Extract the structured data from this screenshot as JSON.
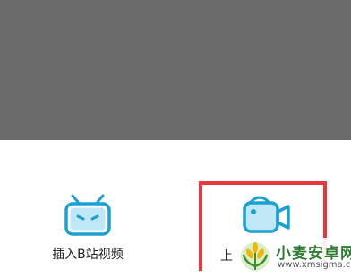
{
  "colors": {
    "overlay": "#6b6b6b",
    "icon_accent": "#1ba0d1",
    "highlight_border": "#e8383d",
    "watermark_green": "#2e7d32"
  },
  "options": {
    "insert_bili_video": {
      "label": "插入B站视频",
      "icon": "bilibili-tv-icon"
    },
    "upload_video": {
      "label_partial": "上",
      "icon": "video-camera-icon"
    }
  },
  "watermark": {
    "title": "小麦安卓网",
    "url": "www.xmsigma.com",
    "icon": "wheat-logo-icon"
  }
}
